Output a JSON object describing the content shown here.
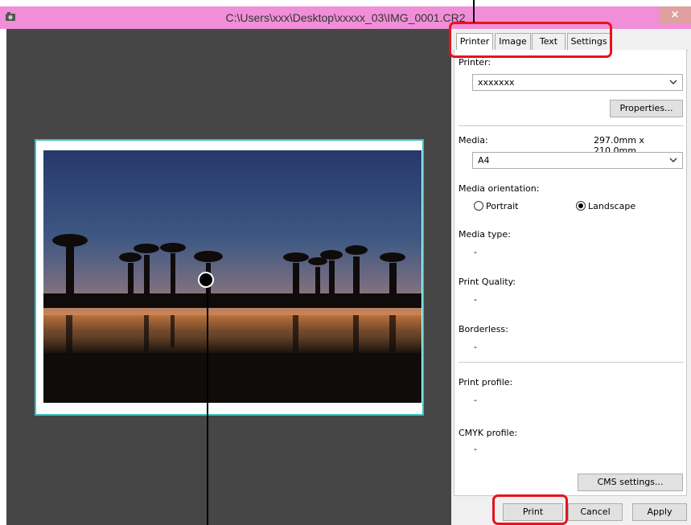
{
  "window": {
    "title": "C:\\Users\\xxx\\Desktop\\xxxxx_03\\IMG_0001.CR2",
    "close_label": "×"
  },
  "tabs": [
    {
      "label": "Printer",
      "active": true
    },
    {
      "label": "Image",
      "active": false
    },
    {
      "label": "Text",
      "active": false
    },
    {
      "label": "Settings",
      "active": false
    }
  ],
  "printer": {
    "label": "Printer:",
    "selected": "xxxxxxx",
    "properties_button": "Properties..."
  },
  "media": {
    "label": "Media:",
    "size_readout": "297.0mm x 210.0mm",
    "selected": "A4"
  },
  "orientation": {
    "label": "Media orientation:",
    "options": [
      {
        "label": "Portrait",
        "selected": false
      },
      {
        "label": "Landscape",
        "selected": true
      }
    ]
  },
  "media_type": {
    "label": "Media type:",
    "value": "-"
  },
  "print_quality": {
    "label": "Print Quality:",
    "value": "-"
  },
  "borderless": {
    "label": "Borderless:",
    "value": "-"
  },
  "print_profile": {
    "label": "Print profile:",
    "value": "-"
  },
  "cmyk_profile": {
    "label": "CMYK profile:",
    "value": "-"
  },
  "cms_settings_button": "CMS settings...",
  "footer": {
    "print_button": "Print",
    "cancel_button": "Cancel",
    "apply_button": "Apply"
  },
  "colors": {
    "titlebar": "#f08fd8",
    "preview_bg": "#464646",
    "frame_border": "#3bbfc0",
    "highlight": "#e8121e"
  }
}
